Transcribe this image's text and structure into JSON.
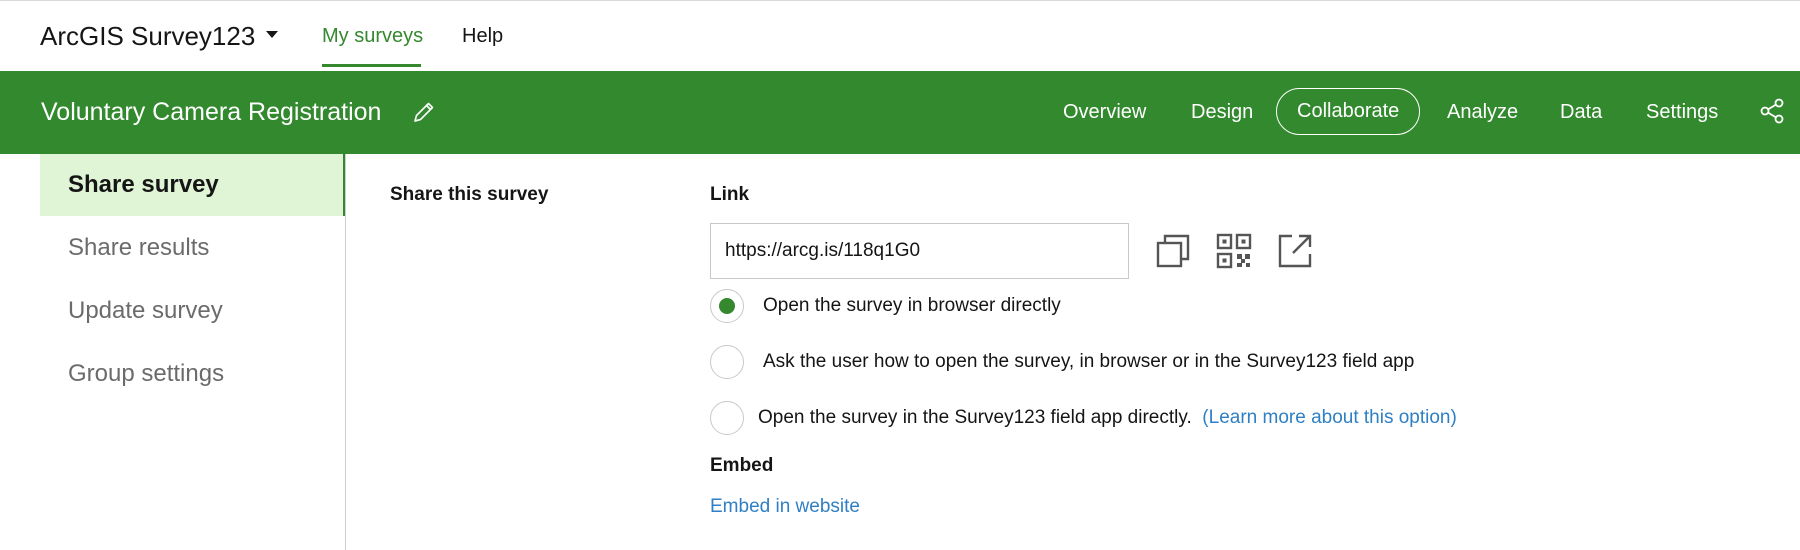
{
  "topbar": {
    "app_title": "ArcGIS Survey123",
    "nav": [
      {
        "label": "My surveys",
        "active": true
      },
      {
        "label": "Help",
        "active": false
      }
    ]
  },
  "header": {
    "survey_title": "Voluntary Camera Registration",
    "tabs": [
      {
        "label": "Overview"
      },
      {
        "label": "Design"
      },
      {
        "label": "Collaborate",
        "selected": true
      },
      {
        "label": "Analyze"
      },
      {
        "label": "Data"
      },
      {
        "label": "Settings"
      }
    ]
  },
  "sidebar": {
    "items": [
      {
        "label": "Share survey",
        "active": true
      },
      {
        "label": "Share results"
      },
      {
        "label": "Update survey"
      },
      {
        "label": "Group settings"
      }
    ]
  },
  "main": {
    "section_label": "Share this survey",
    "link_label": "Link",
    "link_value": "https://arcg.is/118q1G0",
    "options": [
      {
        "label": "Open the survey in browser directly",
        "checked": true
      },
      {
        "label": "Ask the user how to open the survey, in browser or in the Survey123 field app",
        "checked": false
      },
      {
        "label": "Open the survey in the Survey123 field app directly.",
        "link": "(Learn more about this option)",
        "checked": false
      }
    ],
    "embed_label": "Embed",
    "embed_link": "Embed in website"
  },
  "colors": {
    "brand_green": "#33892e",
    "active_bg": "#dff5d6",
    "link_blue": "#2f7fc4"
  },
  "icons": [
    "caret-down-icon",
    "pencil-icon",
    "share-icon",
    "copy-icon",
    "qr-code-icon",
    "open-external-icon"
  ]
}
